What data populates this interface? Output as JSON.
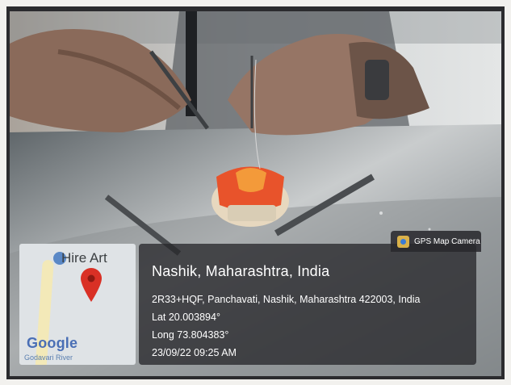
{
  "map": {
    "place_label": "Hire Art",
    "provider_logo": "Google",
    "water_label": "Godavari River",
    "icons": {
      "pin": "map-pin-icon",
      "place": "place-marker-icon"
    },
    "pin_color": "#d93025"
  },
  "app_badge": {
    "label": "GPS Map Camera",
    "icon": "gps-camera-icon"
  },
  "location": {
    "title": "Nashik, Maharashtra, India",
    "address": "2R33+HQF, Panchavati, Nashik, Maharashtra 422003, India",
    "lat": "Lat 20.003894°",
    "long": "Long 73.804383°",
    "datetime": "23/09/22 09:25 AM"
  },
  "colors": {
    "frame": "#2b2b2e",
    "overlay": "#28282c",
    "model_gum": "#e8532b"
  }
}
